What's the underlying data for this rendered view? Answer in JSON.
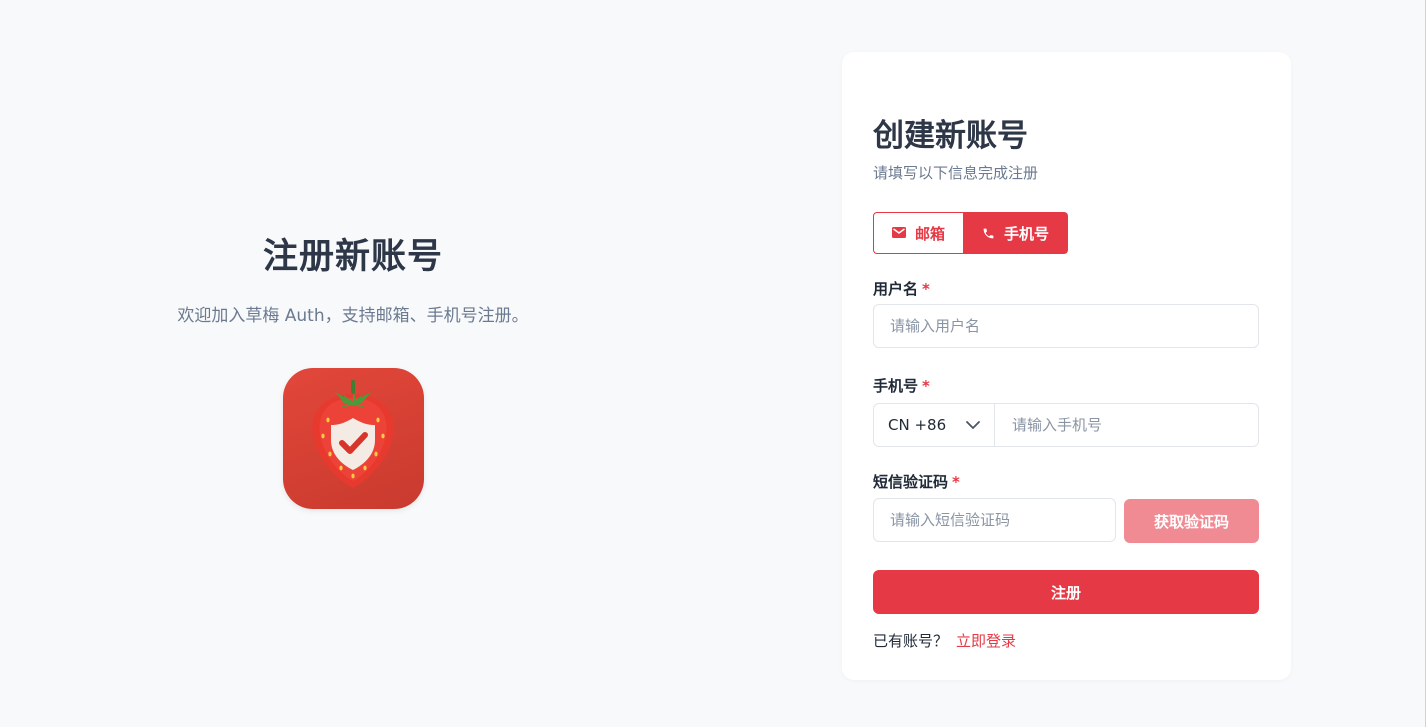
{
  "hero": {
    "title": "注册新账号",
    "subtitle": "欢迎加入草梅 Auth，支持邮箱、手机号注册。",
    "logo_icon": "strawberry-shield-icon"
  },
  "card": {
    "title": "创建新账号",
    "subtitle": "请填写以下信息完成注册",
    "tabs": [
      {
        "label": "邮箱",
        "icon": "mail-icon",
        "active": false
      },
      {
        "label": "手机号",
        "icon": "phone-icon",
        "active": true
      }
    ],
    "username": {
      "label": "用户名",
      "required_mark": "*",
      "placeholder": "请输入用户名",
      "value": ""
    },
    "phone": {
      "label": "手机号",
      "required_mark": "*",
      "country_code": "CN +86",
      "placeholder": "请输入手机号",
      "value": ""
    },
    "sms_code": {
      "label": "短信验证码",
      "required_mark": "*",
      "placeholder": "请输入短信验证码",
      "value": "",
      "send_button": "获取验证码"
    },
    "submit_label": "注册",
    "footer": {
      "prompt": "已有账号？",
      "link": "立即登录"
    }
  },
  "colors": {
    "accent": "#e63946",
    "accent_disabled": "#f08a93",
    "background": "#f8f9fb"
  }
}
